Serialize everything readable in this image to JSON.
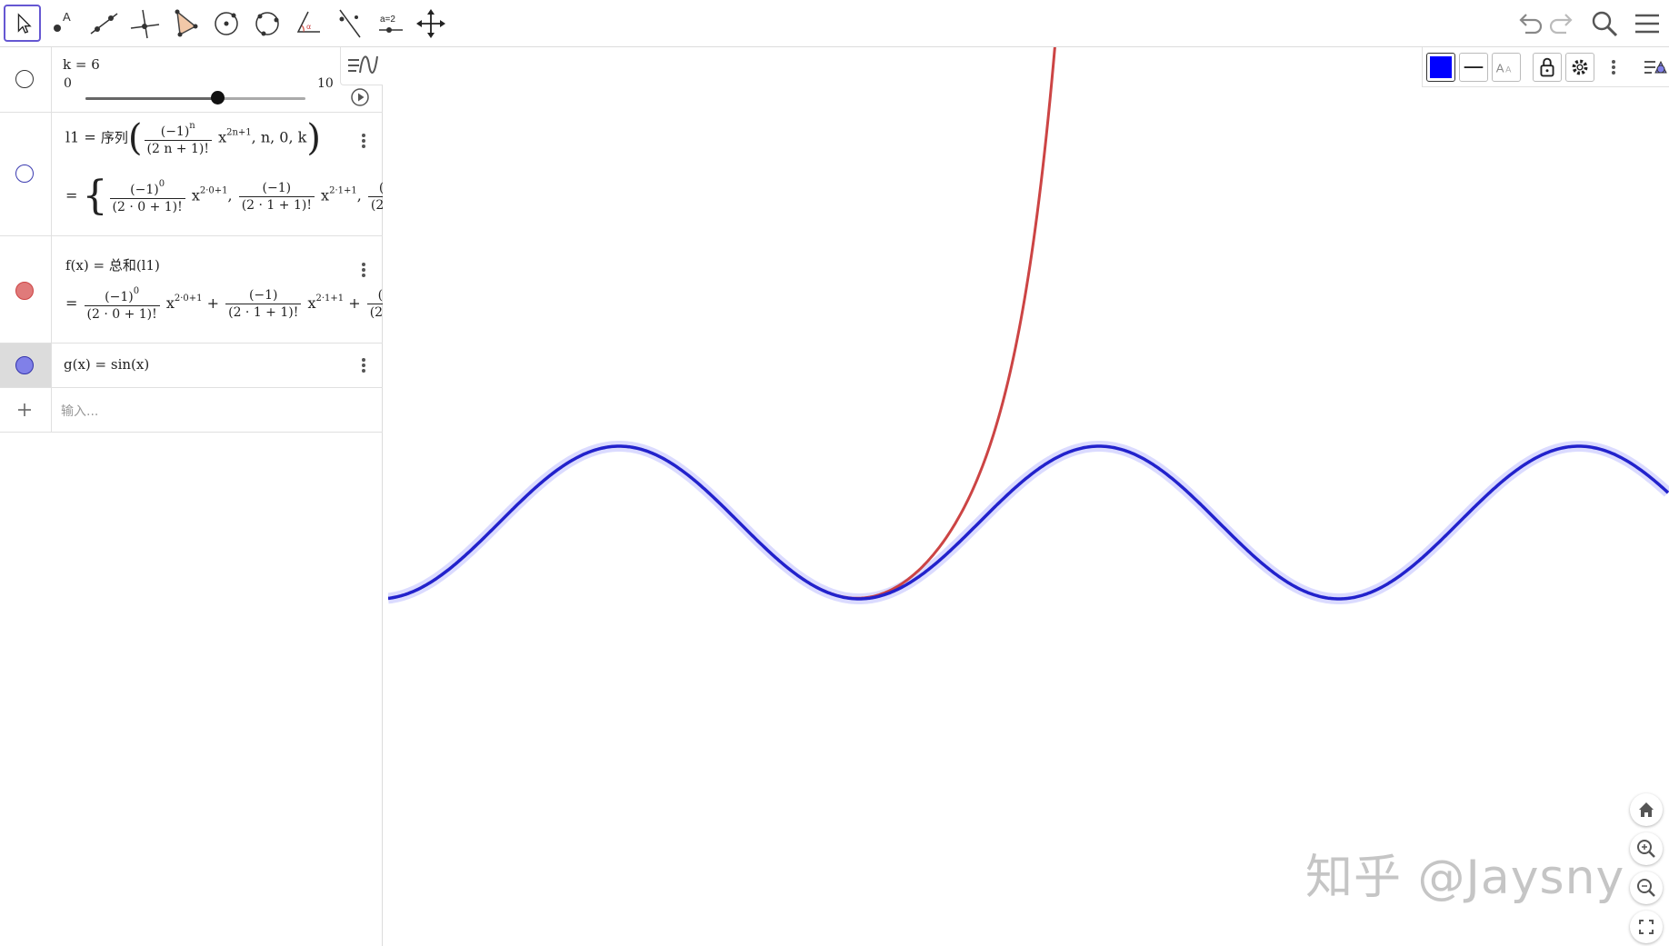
{
  "toolbar": {
    "tools": [
      {
        "name": "move-tool"
      },
      {
        "name": "point-tool"
      },
      {
        "name": "line-tool"
      },
      {
        "name": "perpendicular-line-tool"
      },
      {
        "name": "polygon-tool"
      },
      {
        "name": "circle-tool"
      },
      {
        "name": "circle-through-points-tool"
      },
      {
        "name": "angle-tool"
      },
      {
        "name": "reflect-tool"
      },
      {
        "name": "slider-tool",
        "label": "a=2"
      },
      {
        "name": "move-graphics-view-tool"
      }
    ],
    "active_tool": "move-tool"
  },
  "algebra": {
    "slider": {
      "label": "k = 6",
      "min": "0",
      "max": "10",
      "value": 6,
      "range": [
        0,
        10
      ]
    },
    "l1": {
      "definition_prefix": "l1 =",
      "function_name": "序列",
      "frac_num": "(−1)",
      "frac_num_exp": "n",
      "frac_den": "(2 n + 1)!",
      "power_base": "x",
      "power_exp": "2n+1",
      "args": ", n, 0, k",
      "result_eq": "=",
      "result_items": [
        {
          "num": "(−1)",
          "num_exp": "0",
          "den": "(2 · 0 + 1)!",
          "exp": "2·0+1"
        },
        {
          "num": "(−1)",
          "num_exp": "",
          "den": "(2 · 1 + 1)!",
          "exp": "2·1+1"
        },
        {
          "num": "(",
          "num_exp": "",
          "den": "(2 ·",
          "exp": ""
        }
      ]
    },
    "f": {
      "definition": "f(x) = 总和(l1)",
      "result_eq": "=",
      "result_items": [
        {
          "num": "(−1)",
          "num_exp": "0",
          "den": "(2 · 0 + 1)!",
          "exp": "2·0+1"
        },
        {
          "num": "(−1)",
          "num_exp": "",
          "den": "(2 · 1 + 1)!",
          "exp": "2·1+1"
        },
        {
          "num": "(",
          "num_exp": "",
          "den": "(2 ·",
          "exp": ""
        }
      ]
    },
    "g": {
      "definition": "g(x) = sin(x)"
    },
    "input": {
      "placeholder": "输入..."
    }
  },
  "style_bar": {
    "color": "#0000ff"
  },
  "colors": {
    "f_curve": "#cc4444",
    "g_curve": "#2222cc",
    "g_highlight": "#9999ff",
    "f_marble": "#e07a7a",
    "g_marble": "#8080e8"
  },
  "watermark": "知乎 @Jaysny"
}
